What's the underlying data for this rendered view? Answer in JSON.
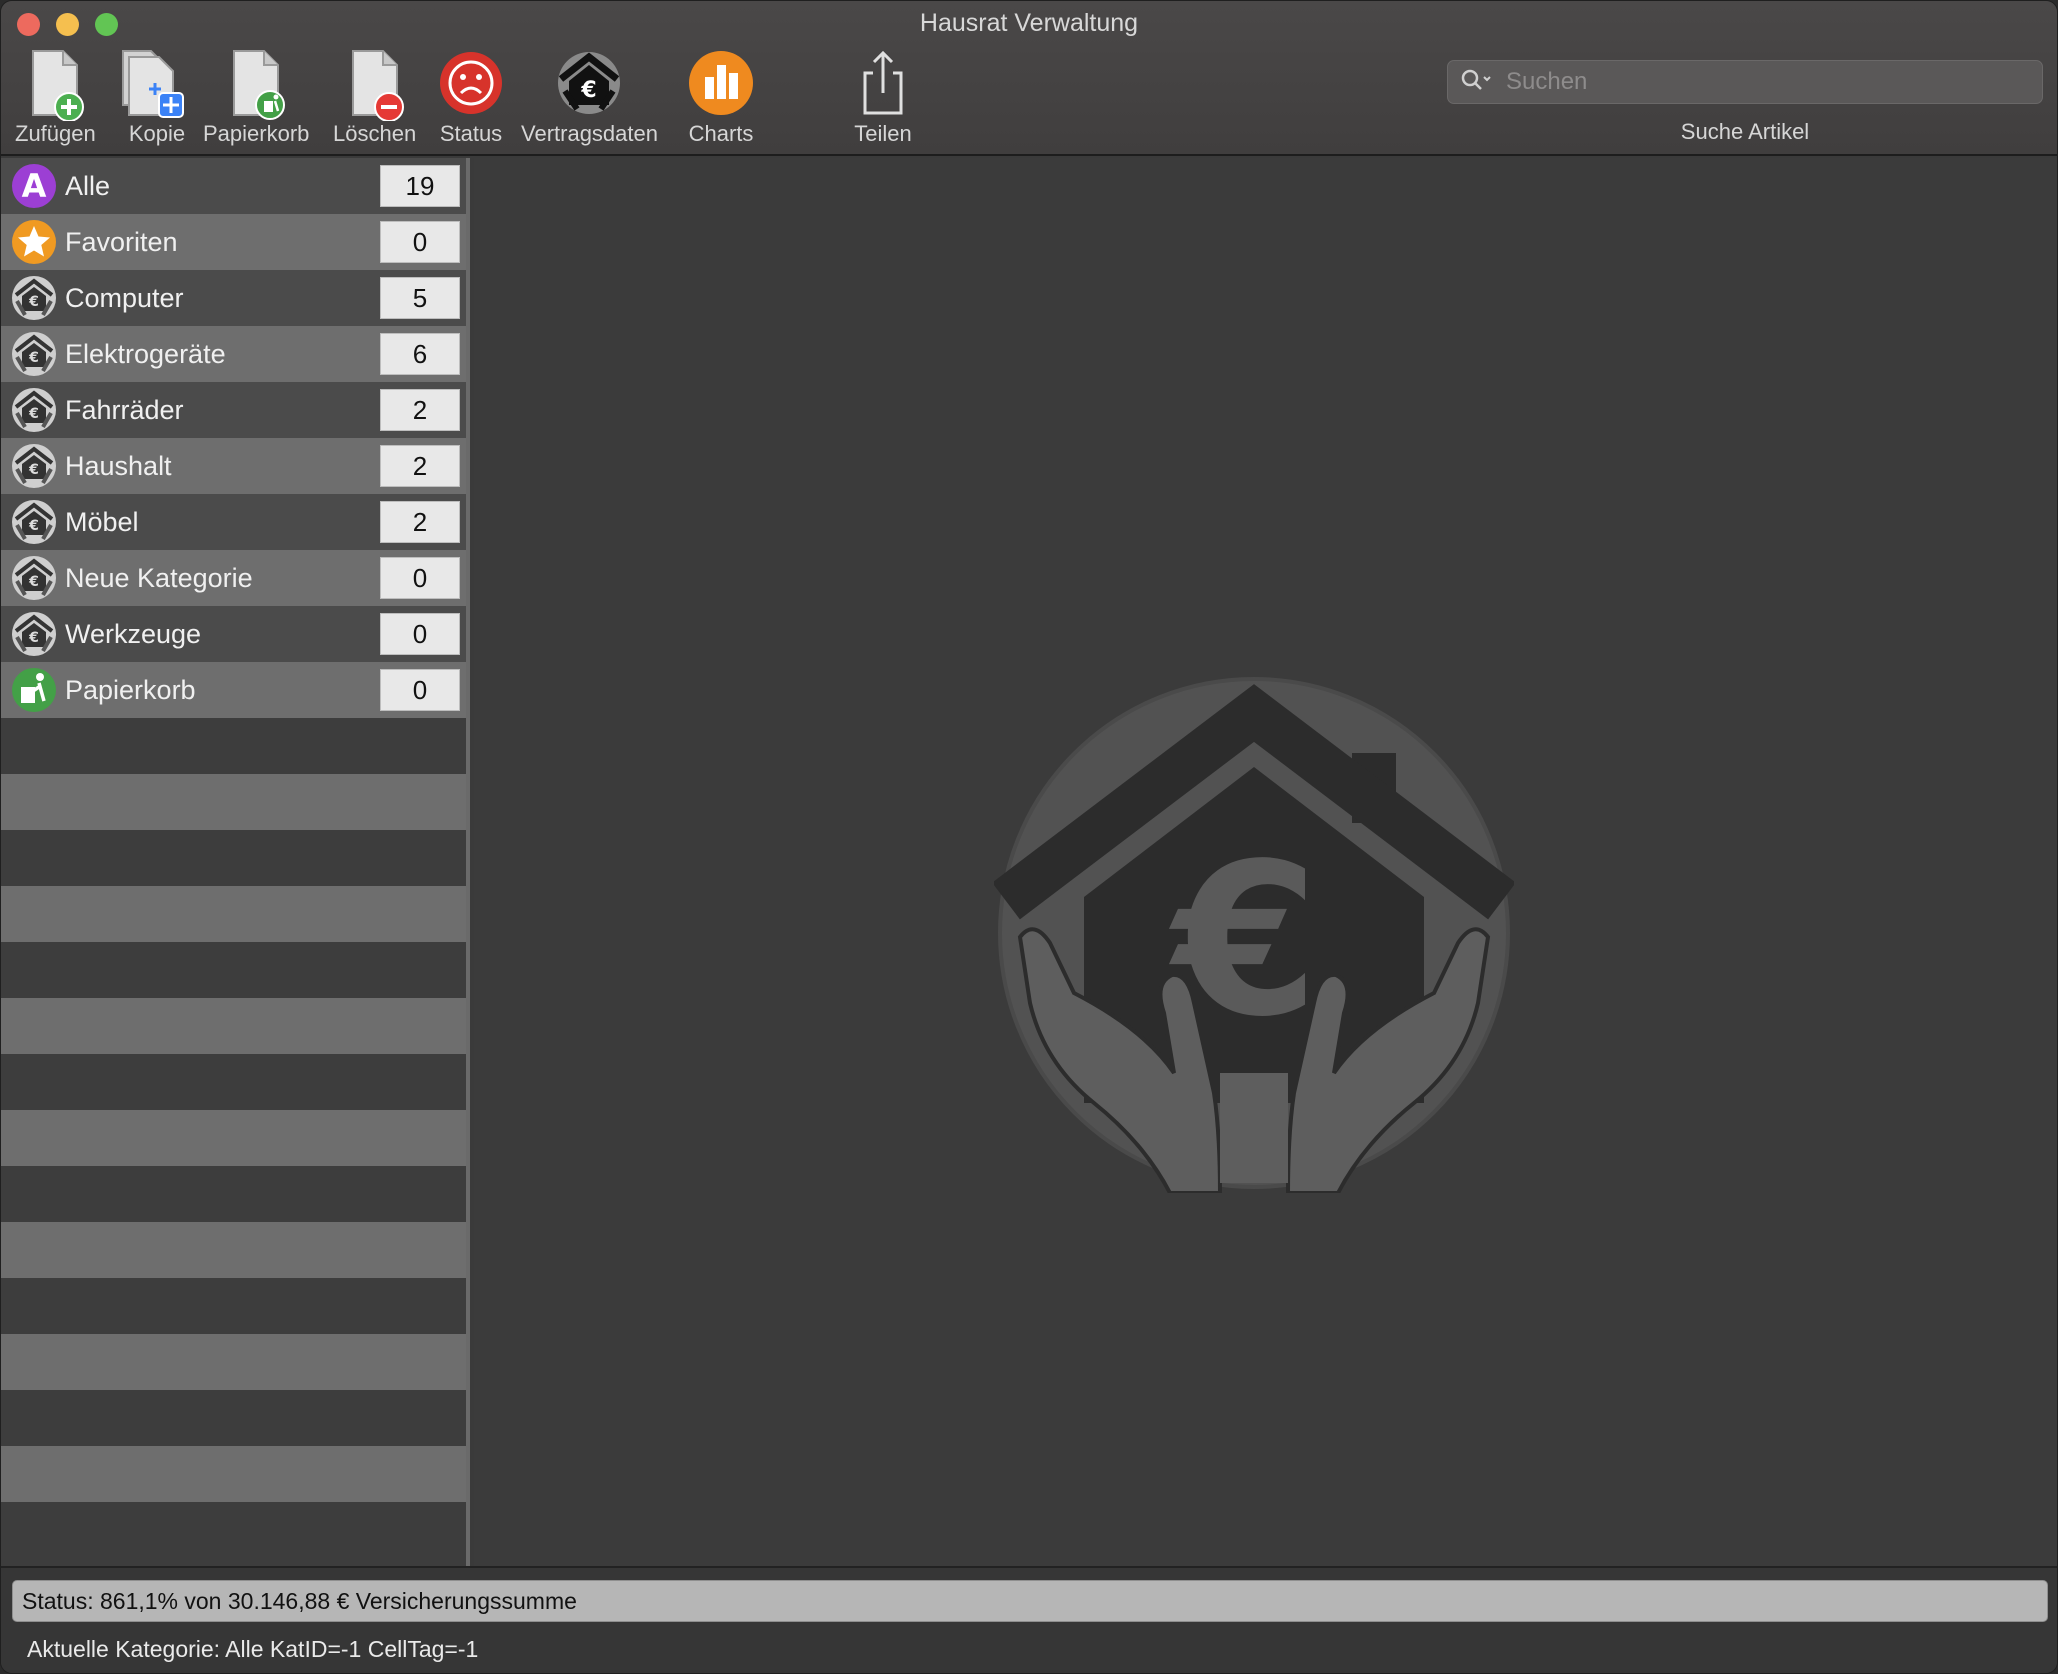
{
  "window": {
    "title": "Hausrat Verwaltung"
  },
  "toolbar": {
    "items": [
      {
        "label": "Zufügen",
        "icon": "add-document-icon"
      },
      {
        "label": "Kopie",
        "icon": "copy-document-icon"
      },
      {
        "label": "Papierkorb",
        "icon": "trash-document-icon"
      },
      {
        "label": "Löschen",
        "icon": "delete-document-icon"
      },
      {
        "label": "Status",
        "icon": "sad-face-icon"
      },
      {
        "label": "Vertragsdaten",
        "icon": "contract-house-icon"
      },
      {
        "label": "Charts",
        "icon": "bar-chart-icon"
      },
      {
        "label": "Teilen",
        "icon": "share-icon"
      }
    ]
  },
  "search": {
    "placeholder": "Suchen",
    "value": "",
    "caption": "Suche Artikel"
  },
  "sidebar": {
    "items": [
      {
        "label": "Alle",
        "count": "19",
        "icon": "letter-a-icon"
      },
      {
        "label": "Favoriten",
        "count": "0",
        "icon": "star-icon"
      },
      {
        "label": "Computer",
        "count": "5",
        "icon": "euro-house-icon"
      },
      {
        "label": "Elektrogeräte",
        "count": "6",
        "icon": "euro-house-icon"
      },
      {
        "label": "Fahrräder",
        "count": "2",
        "icon": "euro-house-icon"
      },
      {
        "label": "Haushalt",
        "count": "2",
        "icon": "euro-house-icon"
      },
      {
        "label": "Möbel",
        "count": "2",
        "icon": "euro-house-icon"
      },
      {
        "label": "Neue Kategorie",
        "count": "0",
        "icon": "euro-house-icon"
      },
      {
        "label": "Werkzeuge",
        "count": "0",
        "icon": "euro-house-icon"
      },
      {
        "label": "Papierkorb",
        "count": "0",
        "icon": "trash-icon"
      }
    ]
  },
  "status": {
    "text": "Status: 861,1% von 30.146,88 € Versicherungssumme",
    "footer": "Aktuelle Kategorie: Alle KatID=-1 CellTag=-1"
  },
  "colors": {
    "add_green": "#4caf50",
    "copy_blue": "#3b82f6",
    "delete_red": "#e53935",
    "status_red": "#d7332b",
    "charts_orange": "#ef8a1f",
    "all_purple": "#9c3fd4",
    "favorite_orange": "#f09a22"
  }
}
